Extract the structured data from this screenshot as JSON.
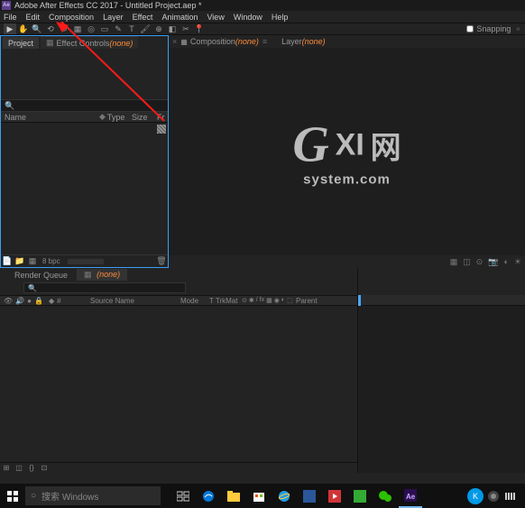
{
  "titlebar": {
    "icon_text": "Ae",
    "title": "Adobe After Effects CC 2017 - Untitled Project.aep *"
  },
  "menu": {
    "file": "File",
    "edit": "Edit",
    "composition": "Composition",
    "layer": "Layer",
    "effect": "Effect",
    "animation": "Animation",
    "view": "View",
    "window": "Window",
    "help": "Help"
  },
  "toolbar": {
    "snapping_label": "Snapping"
  },
  "project": {
    "tab_project": "Project",
    "tab_effect_prefix": "Effect Controls ",
    "tab_effect_none": "(none)",
    "cols": {
      "name": "Name",
      "type": "Type",
      "size": "Size",
      "fr": "Fr"
    },
    "footer_bpc": "8 bpc"
  },
  "composition": {
    "tab_prefix": "Composition ",
    "tab_none": "(none)",
    "layer_prefix": "Layer ",
    "layer_none": "(none)"
  },
  "comp_footer": {
    "zoom": "",
    "res": ""
  },
  "timeline": {
    "tab_render": "Render Queue",
    "tab_none": "(none)",
    "time": "",
    "cols": {
      "num": "#",
      "source": "Source Name",
      "mode": "Mode",
      "trkmat": "T  TrkMat",
      "parent": "Parent"
    }
  },
  "watermark": {
    "g": "G",
    "xi": "XI",
    "w": "网",
    "sys": "system.com"
  },
  "taskbar": {
    "search_placeholder": "搜索 Windows"
  }
}
